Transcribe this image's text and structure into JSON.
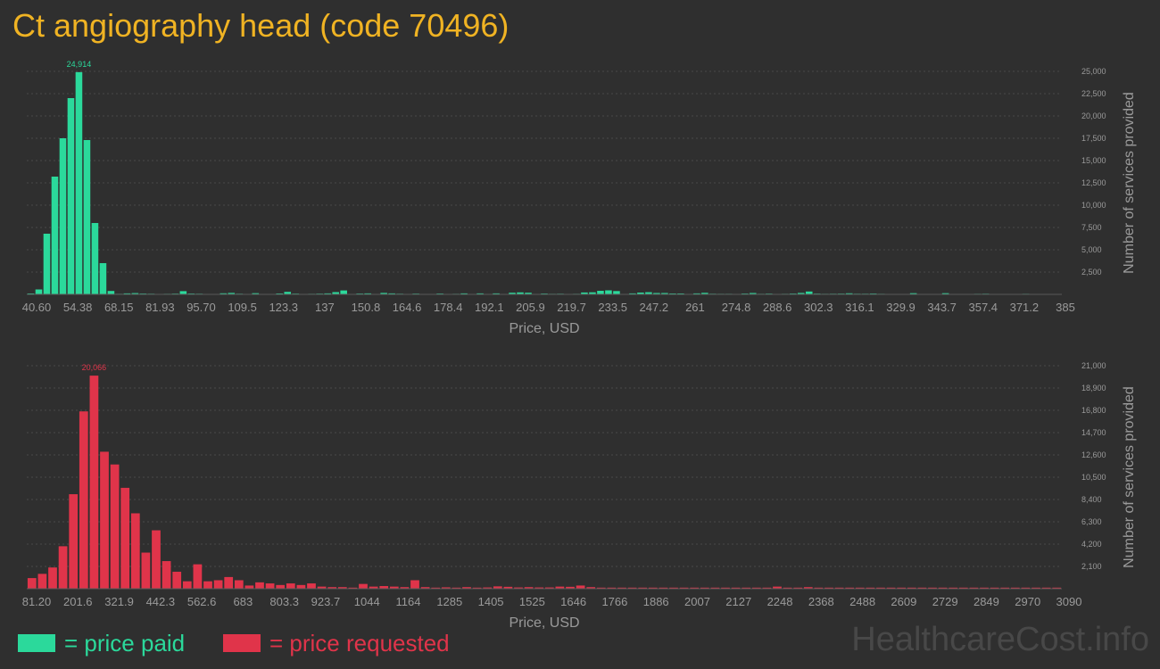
{
  "title": "Ct angiography head (code 70496)",
  "colors": {
    "background": "#2f2f2f",
    "title": "#f0b323",
    "paid": "#2bd99b",
    "requested": "#e0344a",
    "axis_text": "#9a9a9a",
    "grid": "#4a4a4a",
    "watermark": "#484848"
  },
  "legend": {
    "paid_label": "= price paid",
    "requested_label": "= price requested"
  },
  "watermark": "HealthcareCost.info",
  "chart_data": [
    {
      "type": "bar",
      "series_name": "price paid",
      "color": "#2bd99b",
      "xlabel": "Price, USD",
      "ylabel": "Number of services provided",
      "ylim": [
        0,
        25000
      ],
      "y_ticks": [
        "2,500",
        "5,000",
        "7,500",
        "10,000",
        "12,500",
        "15,000",
        "17,500",
        "20,000",
        "22,500",
        "25,000"
      ],
      "x_tick_labels": [
        "40.60",
        "54.38",
        "68.15",
        "81.93",
        "95.70",
        "109.5",
        "123.3",
        "137",
        "150.8",
        "164.6",
        "178.4",
        "192.1",
        "205.9",
        "219.7",
        "233.5",
        "247.2",
        "261",
        "274.8",
        "288.6",
        "302.3",
        "316.1",
        "329.9",
        "343.7",
        "357.4",
        "371.2",
        "385"
      ],
      "peak_label": "24,914",
      "peak_index": 6,
      "values": [
        100,
        550,
        6800,
        13200,
        17500,
        22000,
        24914,
        17300,
        8000,
        3500,
        380,
        60,
        110,
        140,
        90,
        70,
        30,
        60,
        80,
        360,
        90,
        70,
        20,
        30,
        120,
        160,
        70,
        40,
        130,
        40,
        30,
        100,
        280,
        80,
        40,
        60,
        80,
        110,
        250,
        440,
        40,
        90,
        110,
        50,
        160,
        110,
        70,
        40,
        80,
        50,
        40,
        90,
        40,
        60,
        110,
        40,
        110,
        40,
        110,
        50,
        180,
        220,
        180,
        40,
        90,
        60,
        70,
        40,
        60,
        210,
        230,
        400,
        450,
        370,
        40,
        110,
        200,
        240,
        150,
        150,
        100,
        100,
        40,
        110,
        170,
        70,
        60,
        60,
        50,
        90,
        150,
        60,
        80,
        40,
        60,
        90,
        160,
        320,
        80,
        60,
        70,
        80,
        120,
        70,
        70,
        90,
        60,
        20,
        50,
        30,
        130,
        20,
        40,
        30,
        130,
        20,
        40,
        30,
        60,
        70,
        30,
        40,
        20,
        30,
        60,
        40,
        50,
        50,
        30
      ]
    },
    {
      "type": "bar",
      "series_name": "price requested",
      "color": "#e0344a",
      "xlabel": "Price, USD",
      "ylabel": "Number of services provided",
      "ylim": [
        0,
        21000
      ],
      "y_ticks": [
        "2,100",
        "4,200",
        "6,300",
        "8,400",
        "10,500",
        "12,600",
        "14,700",
        "16,800",
        "18,900",
        "21,000"
      ],
      "x_tick_labels": [
        "81.20",
        "201.6",
        "321.9",
        "442.3",
        "562.6",
        "683",
        "803.3",
        "923.7",
        "1044",
        "1164",
        "1285",
        "1405",
        "1525",
        "1646",
        "1766",
        "1886",
        "2007",
        "2127",
        "2248",
        "2368",
        "2488",
        "2609",
        "2729",
        "2849",
        "2970",
        "3090"
      ],
      "peak_label": "20,066",
      "peak_index": 6,
      "values": [
        1000,
        1400,
        2000,
        4000,
        8900,
        16700,
        20066,
        12900,
        11700,
        9500,
        7100,
        3400,
        5500,
        2600,
        1600,
        700,
        2300,
        700,
        800,
        1100,
        800,
        300,
        600,
        500,
        350,
        500,
        350,
        500,
        200,
        150,
        150,
        100,
        450,
        200,
        250,
        200,
        150,
        800,
        150,
        100,
        130,
        100,
        150,
        100,
        120,
        220,
        180,
        120,
        150,
        120,
        120,
        200,
        180,
        300,
        150,
        100,
        100,
        100,
        100,
        100,
        100,
        100,
        100,
        100,
        100,
        100,
        100,
        100,
        100,
        100,
        100,
        100,
        200,
        100,
        100,
        150,
        100,
        100,
        100,
        100,
        100,
        100,
        100,
        100,
        100,
        100,
        100,
        100,
        100,
        100,
        100,
        100,
        100,
        100,
        100,
        100,
        100,
        100,
        100,
        100
      ]
    }
  ]
}
